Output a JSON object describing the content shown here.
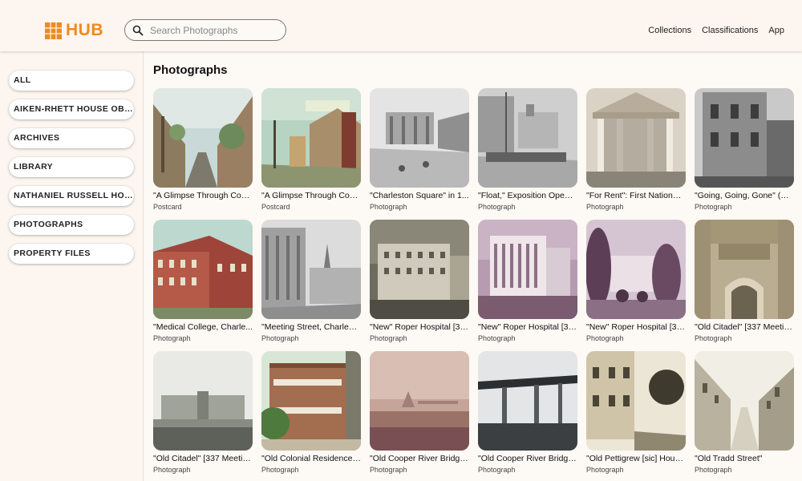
{
  "header": {
    "logo_text": "HUB",
    "search_placeholder": "Search Photographs",
    "nav": [
      "Collections",
      "Classifications",
      "App"
    ],
    "brand_color": "#f08a1c"
  },
  "sidebar": {
    "items": [
      {
        "label": "ALL"
      },
      {
        "label": "AIKEN-RHETT HOUSE OBJE..."
      },
      {
        "label": "ARCHIVES"
      },
      {
        "label": "LIBRARY"
      },
      {
        "label": "NATHANIEL RUSSELL HOUS..."
      },
      {
        "label": "PHOTOGRAPHS"
      },
      {
        "label": "PROPERTY FILES"
      }
    ]
  },
  "main": {
    "title": "Photographs",
    "cards": [
      {
        "title": "\"A Glimpse Through Coo...",
        "type": "Postcard"
      },
      {
        "title": "\"A Glimpse Through Coo...",
        "type": "Postcard"
      },
      {
        "title": "\"Charleston Square\" in 1...",
        "type": "Photograph"
      },
      {
        "title": "\"Float,\" Exposition Openi...",
        "type": "Photograph"
      },
      {
        "title": "\"For Rent\": First National ...",
        "type": "Photograph"
      },
      {
        "title": "\"Going, Going, Gone\" (De...",
        "type": "Photograph"
      },
      {
        "title": "\"Medical College, Charle...",
        "type": "Photograph"
      },
      {
        "title": "\"Meeting Street, Charlest...",
        "type": "Photograph"
      },
      {
        "title": "\"New\" Roper Hospital [31...",
        "type": "Photograph"
      },
      {
        "title": "\"New\" Roper Hospital [31...",
        "type": "Photograph"
      },
      {
        "title": "\"New\" Roper Hospital [31...",
        "type": "Photograph"
      },
      {
        "title": "\"Old Citadel\" [337 Meetin...",
        "type": "Photograph"
      },
      {
        "title": "\"Old Citadel\" [337 Meetin...",
        "type": "Photograph"
      },
      {
        "title": "\"Old Colonial Residences...",
        "type": "Photograph"
      },
      {
        "title": "\"Old Cooper River Bridge...",
        "type": "Photograph"
      },
      {
        "title": "\"Old Cooper River Bridge...",
        "type": "Photograph"
      },
      {
        "title": "\"Old Pettigrew [sic] House\"",
        "type": "Photograph"
      },
      {
        "title": "\"Old Tradd Street\"",
        "type": "Photograph"
      }
    ]
  }
}
